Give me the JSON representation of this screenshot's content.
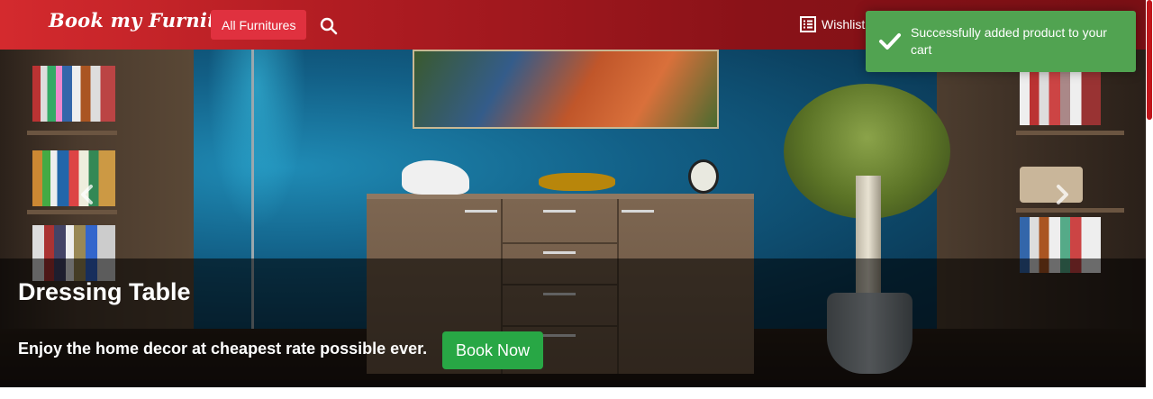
{
  "navbar": {
    "brand": "Book my Furniture",
    "all_furnitures": "All Furnitures",
    "search_icon": "search-icon",
    "wishlist_label": "Wishlist",
    "wishlist_icon": "list-icon"
  },
  "hero": {
    "title": "Dressing Table",
    "subtitle": "Enjoy the home decor at cheapest rate possible ever.",
    "cta_label": "Book Now",
    "prev_icon": "chevron-left-icon",
    "next_icon": "chevron-right-icon"
  },
  "toast": {
    "message": "Successfully added product to your cart",
    "icon": "checkmark-icon"
  },
  "colors": {
    "navbar_start": "#d42a2e",
    "navbar_end": "#7a1015",
    "pill": "#e0313f",
    "cta": "#28a745",
    "toast": "#51a351",
    "scrollbar": "#c0161c"
  }
}
